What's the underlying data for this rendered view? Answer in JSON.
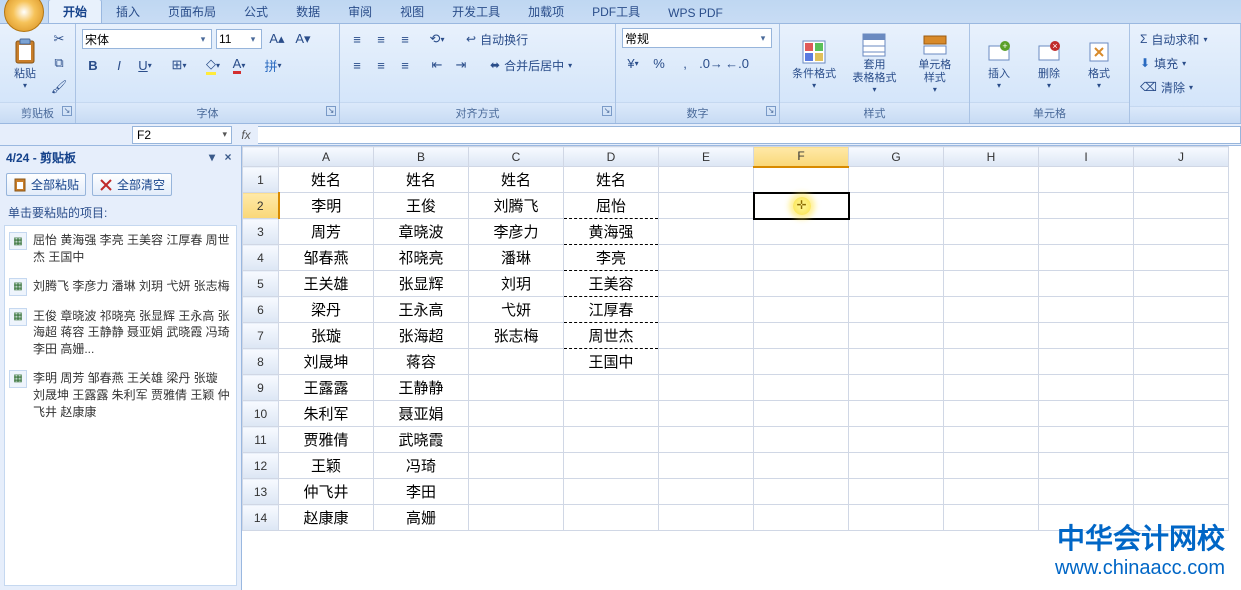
{
  "tabs": {
    "items": [
      "开始",
      "插入",
      "页面布局",
      "公式",
      "数据",
      "审阅",
      "视图",
      "开发工具",
      "加载项",
      "PDF工具",
      "WPS PDF"
    ],
    "active": 0
  },
  "ribbon": {
    "clipboard": {
      "title": "剪贴板",
      "paste": "粘贴"
    },
    "font": {
      "title": "字体",
      "name": "宋体",
      "size": "11"
    },
    "align": {
      "title": "对齐方式",
      "wrap": "自动换行",
      "merge": "合并后居中"
    },
    "number": {
      "title": "数字",
      "format": "常规"
    },
    "styles": {
      "title": "样式",
      "cond": "条件格式",
      "table": "套用\n表格格式",
      "cell": "单元格\n样式"
    },
    "cells": {
      "title": "单元格",
      "insert": "插入",
      "delete": "删除",
      "format": "格式"
    },
    "editing": {
      "sum": "自动求和",
      "fill": "填充",
      "clear": "清除"
    }
  },
  "formula_bar": {
    "cell_ref": "F2",
    "formula": ""
  },
  "clipboard_pane": {
    "title": "4/24 - 剪贴板",
    "paste_all": "全部粘贴",
    "clear_all": "全部清空",
    "hint": "单击要粘贴的项目:",
    "items": [
      "屈怡 黄海强 李亮 王美容 江厚春 周世杰 王国中",
      "刘腾飞 李彦力 潘琳 刘玥 弋妍 张志梅",
      "王俊 章晓波 祁晓亮 张显辉 王永高 张海超 蒋容 王静静 聂亚娟 武晓霞 冯琦 李田 高姗...",
      "李明 周芳 邹春燕 王关雄 梁丹 张璇 刘晟坤 王露露 朱利军 贾雅倩 王颖 仲飞井 赵康康"
    ]
  },
  "chart_data": {
    "type": "table",
    "columns": [
      "A",
      "B",
      "C",
      "D",
      "E",
      "F",
      "G",
      "H",
      "I",
      "J"
    ],
    "headers_row": [
      "姓名",
      "姓名",
      "姓名",
      "姓名"
    ],
    "rows": [
      [
        "李明",
        "王俊",
        "刘腾飞",
        "屈怡"
      ],
      [
        "周芳",
        "章晓波",
        "李彦力",
        "黄海强"
      ],
      [
        "邹春燕",
        "祁晓亮",
        "潘琳",
        "李亮"
      ],
      [
        "王关雄",
        "张显辉",
        "刘玥",
        "王美容"
      ],
      [
        "梁丹",
        "王永高",
        "弋妍",
        "江厚春"
      ],
      [
        "张璇",
        "张海超",
        "张志梅",
        "周世杰"
      ],
      [
        "刘晟坤",
        "蒋容",
        "",
        "王国中"
      ],
      [
        "王露露",
        "王静静",
        "",
        ""
      ],
      [
        "朱利军",
        "聂亚娟",
        "",
        ""
      ],
      [
        "贾雅倩",
        "武晓霞",
        "",
        ""
      ],
      [
        "王颖",
        "冯琦",
        "",
        ""
      ],
      [
        "仲飞井",
        "李田",
        "",
        ""
      ],
      [
        "赵康康",
        "高姗",
        "",
        ""
      ]
    ],
    "row_numbers": [
      1,
      2,
      3,
      4,
      5,
      6,
      7,
      8,
      9,
      10,
      11,
      12,
      13,
      14
    ],
    "selected_cell": "F2",
    "marching_ants_range": "D2:D8"
  },
  "watermark": {
    "line1": "中华会计网校",
    "line2": "www.chinaacc.com"
  }
}
